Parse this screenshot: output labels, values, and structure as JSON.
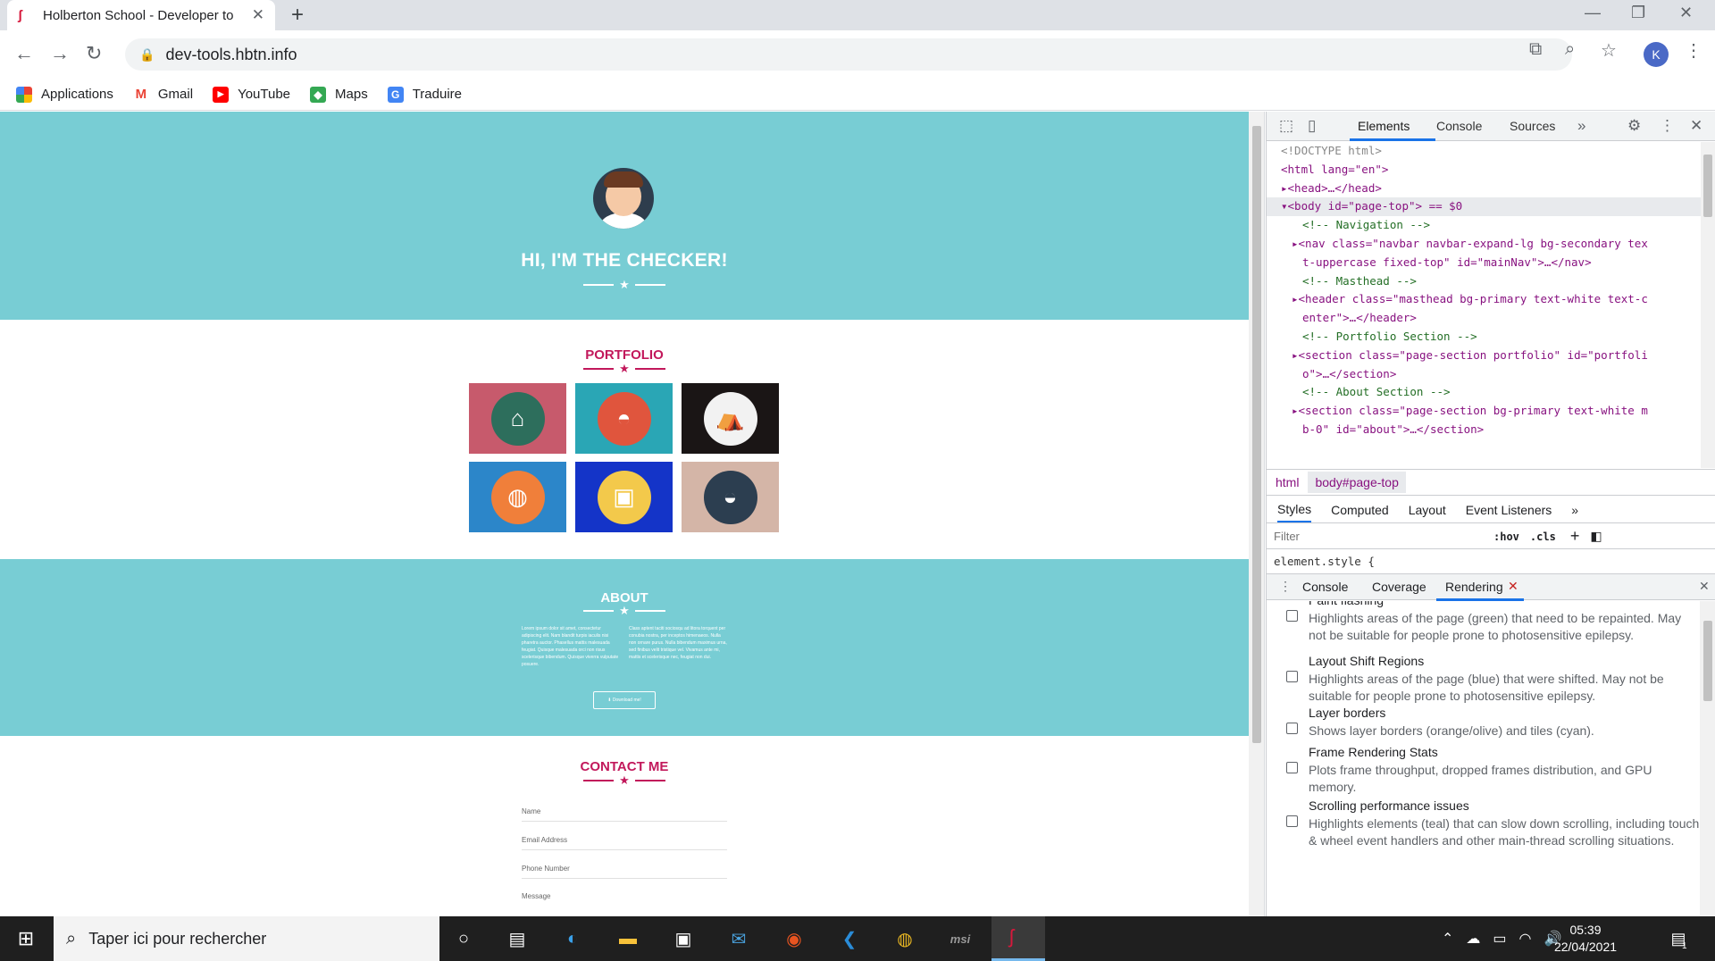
{
  "browser": {
    "tab_title": "Holberton School - Developer to",
    "url": "dev-tools.hbtn.info",
    "bookmarks": [
      "Applications",
      "Gmail",
      "YouTube",
      "Maps",
      "Traduire"
    ],
    "profile_initial": "K"
  },
  "page": {
    "hero_title": "HI, I'M THE CHECKER!",
    "portfolio_title": "PORTFOLIO",
    "portfolio_items": [
      {
        "bg": "#c75a6c",
        "icon": "cabin-icon"
      },
      {
        "bg": "#2aa6b5",
        "icon": "cake-icon"
      },
      {
        "bg": "#1a1515",
        "icon": "circus-tent-icon"
      },
      {
        "bg": "#2c86c9",
        "icon": "game-controller-icon"
      },
      {
        "bg": "#1434c8",
        "icon": "safe-icon"
      },
      {
        "bg": "#d4b5a7",
        "icon": "submarine-icon"
      }
    ],
    "about_title": "ABOUT",
    "about_left": "Lorem ipsum dolor sit amet, consectetur adipiscing elit. Nam blandit turpis iaculis nisi pharetra auctor. Phasellus mattis malesuada feugiat. Quisque malesuada orci non risus scelerisque bibendum. Quisque viverra vulputate posuere.",
    "about_right": "Class aptent taciti sociosqu ad litora torquent per conubia nostra, per inceptos himenaeos. Nulla non ornare purus. Nulla bibendum maximus urna, sed finibus velit tristique vel. Vivamus ante mi, mattis et scelerisque nec, feugiat non dui.",
    "download_label": "Download me!",
    "contact_title": "CONTACT ME",
    "contact_fields": [
      "Name",
      "Email Address",
      "Phone Number",
      "Message"
    ],
    "colors": {
      "teal": "#78cdd4",
      "accent": "#c2185b"
    }
  },
  "devtools": {
    "tabs": [
      "Elements",
      "Console",
      "Sources"
    ],
    "dom_lines": [
      {
        "t": "<!DOCTYPE html>",
        "k": "gr",
        "i": 0
      },
      {
        "t": "<html lang=\"en\">",
        "k": "tg",
        "i": 0
      },
      {
        "t": "▸<head>…</head>",
        "k": "tg",
        "i": 0
      },
      {
        "t": "▾<body id=\"page-top\"> == $0",
        "k": "tg",
        "i": 0,
        "sel": true
      },
      {
        "t": "<!-- Navigation -->",
        "k": "cm",
        "i": 2
      },
      {
        "t": "▸<nav class=\"navbar navbar-expand-lg bg-secondary tex",
        "k": "tg",
        "i": 1
      },
      {
        "t": "t-uppercase fixed-top\" id=\"mainNav\">…</nav>",
        "k": "tg",
        "i": 2
      },
      {
        "t": "<!-- Masthead -->",
        "k": "cm",
        "i": 2
      },
      {
        "t": "▸<header class=\"masthead bg-primary text-white text-c",
        "k": "tg",
        "i": 1
      },
      {
        "t": "enter\">…</header>",
        "k": "tg",
        "i": 2
      },
      {
        "t": "<!-- Portfolio Section -->",
        "k": "cm",
        "i": 2
      },
      {
        "t": "▸<section class=\"page-section portfolio\" id=\"portfoli",
        "k": "tg",
        "i": 1
      },
      {
        "t": "o\">…</section>",
        "k": "tg",
        "i": 2
      },
      {
        "t": "<!-- About Section -->",
        "k": "cm",
        "i": 2
      },
      {
        "t": "▸<section class=\"page-section bg-primary text-white m",
        "k": "tg",
        "i": 1
      },
      {
        "t": "b-0\" id=\"about\">…</section>",
        "k": "tg",
        "i": 2
      }
    ],
    "breadcrumb": [
      "html",
      "body#page-top"
    ],
    "styles_tabs": [
      "Styles",
      "Computed",
      "Layout",
      "Event Listeners"
    ],
    "filter_placeholder": "Filter",
    "hov": ":hov",
    "cls": ".cls",
    "element_style": "element.style {",
    "drawer_tabs": [
      "Console",
      "Coverage",
      "Rendering"
    ],
    "rendering": [
      {
        "title": "Paint flashing",
        "desc": "Highlights areas of the page (green) that need to be repainted. May not be suitable for people prone to photosensitive epilepsy."
      },
      {
        "title": "Layout Shift Regions",
        "desc": "Highlights areas of the page (blue) that were shifted. May not be suitable for people prone to photosensitive epilepsy."
      },
      {
        "title": "Layer borders",
        "desc": "Shows layer borders (orange/olive) and tiles (cyan)."
      },
      {
        "title": "Frame Rendering Stats",
        "desc": "Plots frame throughput, dropped frames distribution, and GPU memory."
      },
      {
        "title": "Scrolling performance issues",
        "desc": "Highlights elements (teal) that can slow down scrolling, including touch & wheel event handlers and other main-thread scrolling situations."
      }
    ]
  },
  "taskbar": {
    "search_placeholder": "Taper ici pour rechercher",
    "time": "05:39",
    "date": "22/04/2021",
    "notifications": "1"
  }
}
